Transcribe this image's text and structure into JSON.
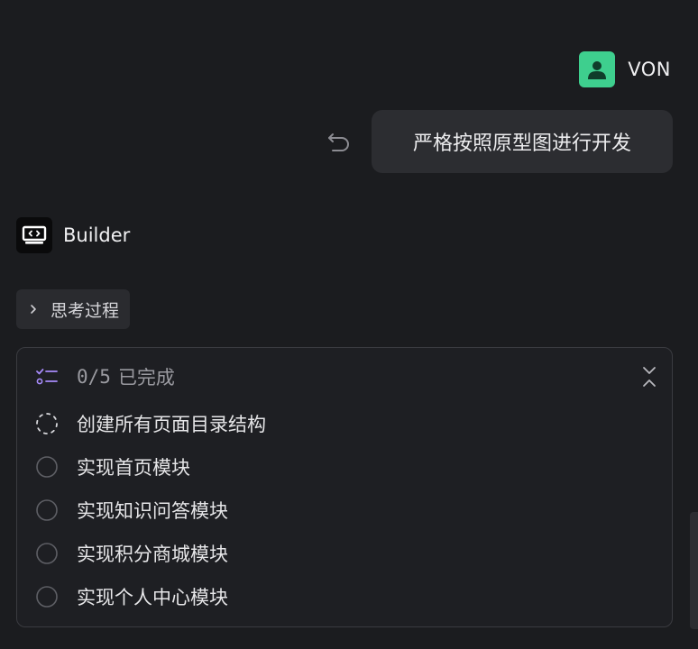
{
  "user": {
    "name": "VON",
    "avatar_icon": "person-icon",
    "avatar_color": "#3ecf8e"
  },
  "message": {
    "text": "严格按照原型图进行开发",
    "undo_icon": "undo-icon"
  },
  "assistant": {
    "name": "Builder",
    "logo_icon": "builder-logo-icon"
  },
  "thinking": {
    "label": "思考过程",
    "icon": "chevron-right-icon"
  },
  "tasks": {
    "progress": "0/5",
    "status_label": "已完成",
    "header_icon": "checklist-icon",
    "collapse_icon": "collapse-icon",
    "accent_color": "#a78bfa",
    "items": [
      {
        "label": "创建所有页面目录结构",
        "state": "in-progress"
      },
      {
        "label": "实现首页模块",
        "state": "pending"
      },
      {
        "label": "实现知识问答模块",
        "state": "pending"
      },
      {
        "label": "实现积分商城模块",
        "state": "pending"
      },
      {
        "label": "实现个人中心模块",
        "state": "pending"
      }
    ]
  }
}
